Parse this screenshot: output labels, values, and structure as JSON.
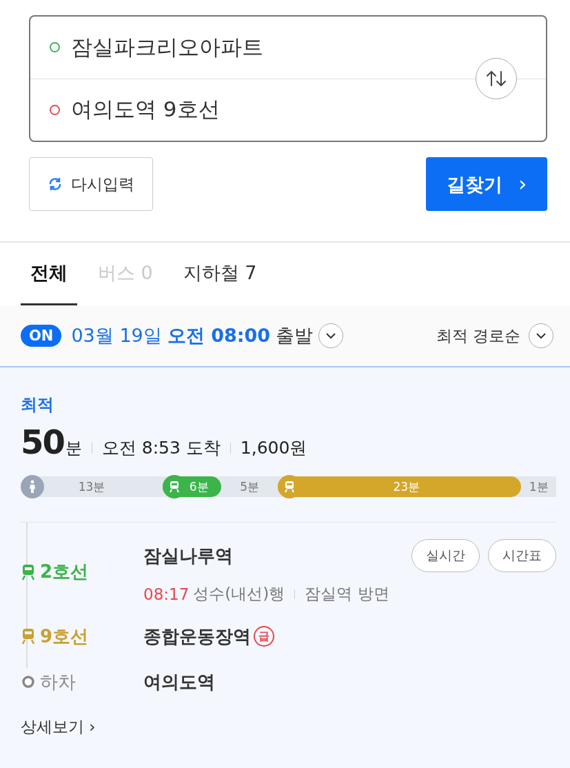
{
  "search": {
    "origin": {
      "value": "잠실파크리오아파트",
      "color": "#3cb45a"
    },
    "destination": {
      "value": "여의도역 9호선",
      "color": "#e0505a"
    },
    "reset_button": "다시입력",
    "search_button": "길찾기",
    "search_button_arrow": "›"
  },
  "tabs": [
    {
      "label": "전체",
      "selected": true,
      "disabled": false
    },
    {
      "label": "버스 0",
      "selected": false,
      "disabled": true
    },
    {
      "label": "지하철 7",
      "selected": false,
      "disabled": false
    }
  ],
  "departure": {
    "toggle": {
      "label": "ON",
      "on": true
    },
    "date": "03월 19일",
    "time": "오전 08:00",
    "suffix": "출발",
    "sort": "최적 경로순"
  },
  "route": {
    "badge": "최적",
    "duration": "50",
    "duration_unit": "분",
    "arrival": "오전 8:53 도착",
    "fare": "1,600원",
    "segments": [
      {
        "kind": "walk",
        "label": "13분",
        "color": "#9aa6b8"
      },
      {
        "kind": "subway",
        "label": "6분",
        "color": "#3bb44a"
      },
      {
        "kind": "wait",
        "label": "5분",
        "color": "#e3e7ee"
      },
      {
        "kind": "subway",
        "label": "23분",
        "color": "#d4a62a"
      },
      {
        "kind": "wait",
        "label": "1분",
        "color": "#e3e7ee"
      }
    ],
    "steps": [
      {
        "kind": "subway",
        "line": "2호선",
        "color": "#3bb44a",
        "station": "잠실나루역",
        "buttons": [
          "실시간",
          "시간표"
        ],
        "arrival_time": "08:17",
        "direction": "성수(내선)행",
        "platform": "잠실역 방면"
      },
      {
        "kind": "subway",
        "line": "9호선",
        "color": "#c9a033",
        "station": "종합운동장역",
        "express": "급"
      },
      {
        "kind": "alight",
        "line": "하차",
        "color": "#888888",
        "station": "여의도역"
      }
    ],
    "details_link": "상세보기",
    "details_arrow": "›"
  }
}
